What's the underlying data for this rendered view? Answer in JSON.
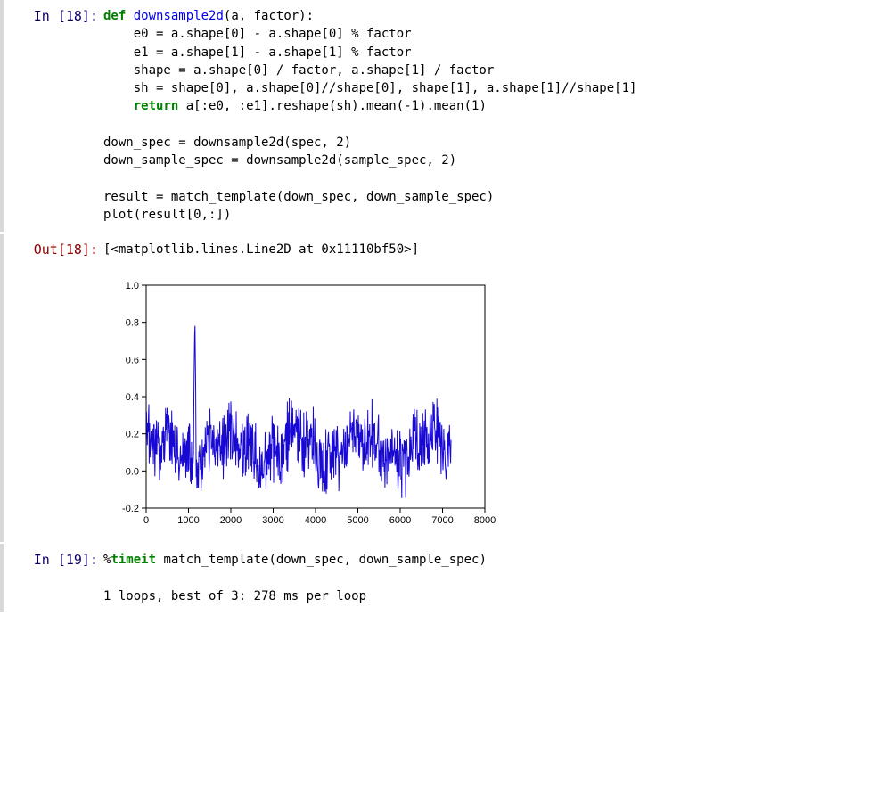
{
  "cells": {
    "c0": {
      "in_label": "In [18]:",
      "out_label": "Out[18]:",
      "code_html": "<span class=\"kw\">def</span> <span class=\"fn\">downsample2d</span>(a, factor):\n    e0 = a.shape[0] - a.shape[0] % factor\n    e1 = a.shape[1] - a.shape[1] % factor\n    shape = a.shape[0] / factor, a.shape[1] / factor\n    sh = shape[0], a.shape[0]//shape[0], shape[1], a.shape[1]//shape[1]\n    <span class=\"kw\">return</span> a[:e0, :e1].reshape(sh).mean(-1).mean(1)\n\ndown_spec = downsample2d(spec, 2)\ndown_sample_spec = downsample2d(sample_spec, 2)\n\nresult = match_template(down_spec, down_sample_spec)\nplot(result[0,:])",
      "output_text": "[<matplotlib.lines.Line2D at 0x11110bf50>]"
    },
    "c1": {
      "in_label": "In [19]:",
      "code_html": "%<span class=\"mag\">timeit</span> match_template(down_spec, down_sample_spec)",
      "output_text": "1 loops, best of 3: 278 ms per loop"
    }
  },
  "chart_data": {
    "type": "line",
    "title": "",
    "xlabel": "",
    "ylabel": "",
    "xlim": [
      0,
      8000
    ],
    "ylim": [
      -0.2,
      1.0
    ],
    "x_ticks": [
      0,
      1000,
      2000,
      3000,
      4000,
      5000,
      6000,
      7000,
      8000
    ],
    "y_ticks": [
      -0.2,
      0.0,
      0.2,
      0.4,
      0.6,
      0.8,
      1.0
    ],
    "data_description": "Noisy correlation signal, baseline ~0.0–0.3, single tall spike rising to ~0.85 near x≈1150",
    "spike": {
      "x": 1150,
      "y": 0.85
    }
  }
}
